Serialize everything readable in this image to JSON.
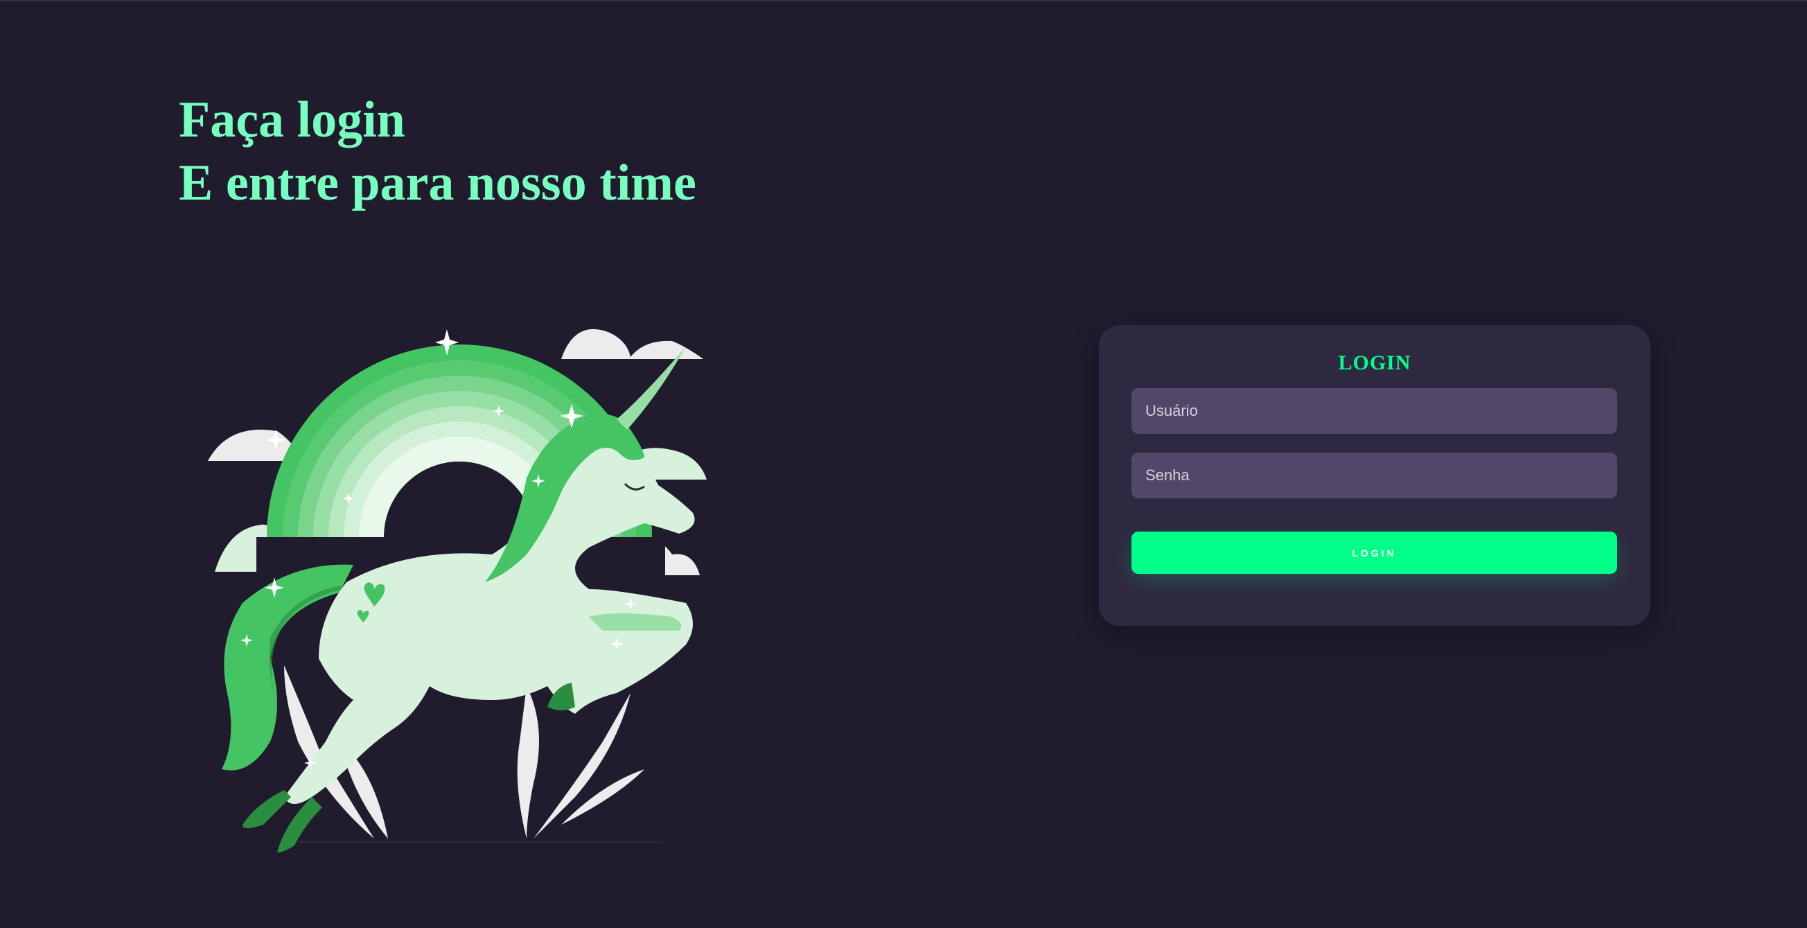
{
  "hero": {
    "line1": "Faça login",
    "line2": "E entre para nosso time",
    "color": "#77ffc0"
  },
  "illustration": {
    "icon": "unicorn-rainbow-illustration",
    "colors": {
      "green": "#45c463",
      "mint": "#d8f1dd",
      "dark_green": "#2b8d3f",
      "cloud": "#ececec"
    }
  },
  "login_card": {
    "title": "LOGIN",
    "username_placeholder": "Usuário",
    "password_placeholder": "Senha",
    "button_label": "LOGIN",
    "accent": "#00ff88",
    "background": "#2f2841",
    "field_background": "#514869"
  },
  "page": {
    "background": "#201b2d"
  }
}
